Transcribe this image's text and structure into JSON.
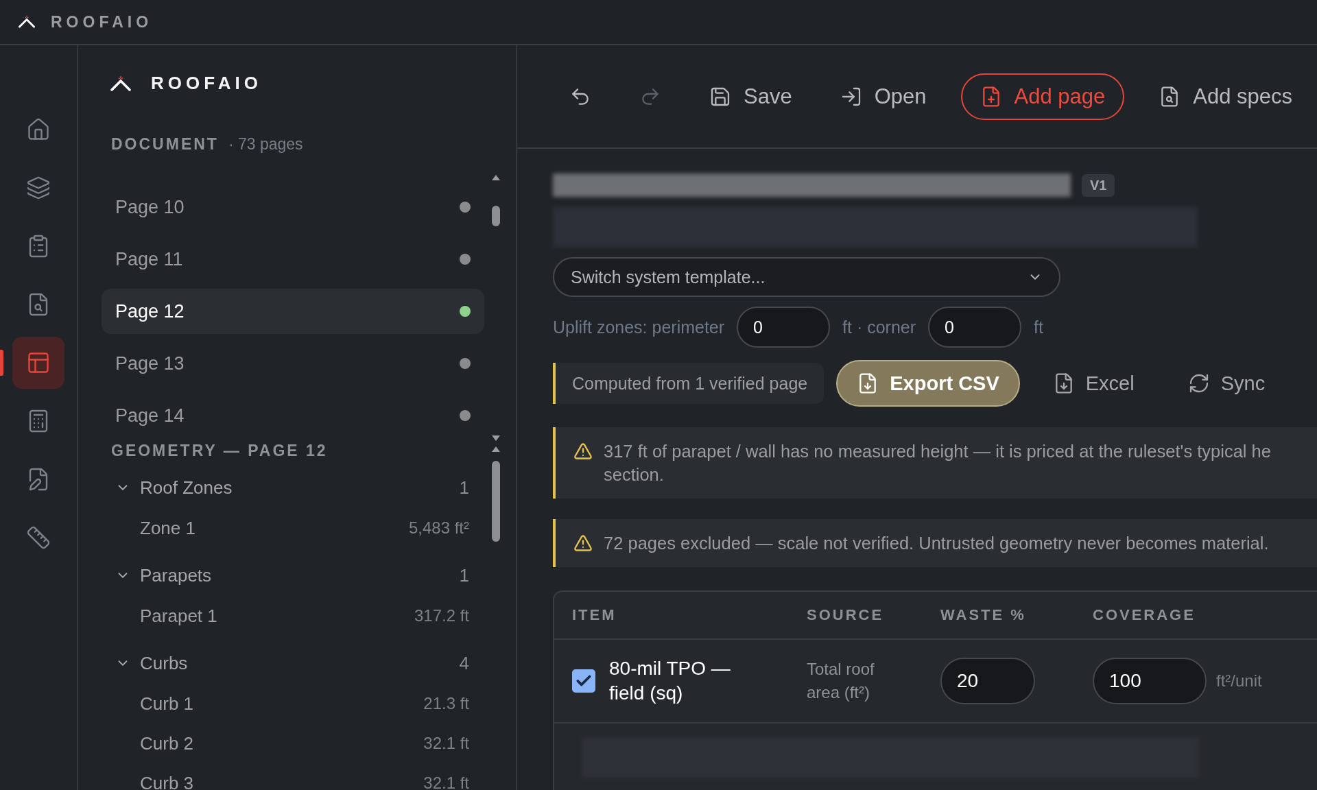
{
  "app_bar": {
    "brand": "ROOFAIO"
  },
  "rail": {
    "items": [
      {
        "selected": false
      },
      {
        "selected": false
      },
      {
        "selected": false
      },
      {
        "selected": false
      },
      {
        "selected": true
      },
      {
        "selected": false
      },
      {
        "selected": false
      },
      {
        "selected": false
      }
    ]
  },
  "sidebar": {
    "brand": "ROOFAIO",
    "document": {
      "heading": "DOCUMENT",
      "count": "· 73 pages",
      "pages": [
        {
          "label": "Page 10",
          "selected": false,
          "color": "#8a8b8d"
        },
        {
          "label": "Page 11",
          "selected": false,
          "color": "#8a8b8d"
        },
        {
          "label": "Page 12",
          "selected": true,
          "color": "#8fd18a"
        },
        {
          "label": "Page 13",
          "selected": false,
          "color": "#8a8b8d"
        },
        {
          "label": "Page 14",
          "selected": false,
          "color": "#8a8b8d"
        }
      ]
    },
    "geometry": {
      "heading": "GEOMETRY — PAGE 12",
      "groups": [
        {
          "label": "Roof Zones",
          "count": "1",
          "expanded": true,
          "children": [
            {
              "label": "Zone 1",
              "value": "5,483 ft²"
            }
          ]
        },
        {
          "label": "Parapets",
          "count": "1",
          "expanded": true,
          "children": [
            {
              "label": "Parapet 1",
              "value": "317.2 ft"
            }
          ]
        },
        {
          "label": "Curbs",
          "count": "4",
          "expanded": true,
          "children": [
            {
              "label": "Curb 1",
              "value": "21.3 ft"
            },
            {
              "label": "Curb 2",
              "value": "32.1 ft"
            },
            {
              "label": "Curb 3",
              "value": "32.1 ft"
            }
          ]
        }
      ]
    }
  },
  "toolbar": {
    "items": [
      {
        "kind": "undo",
        "disabled": false
      },
      {
        "kind": "redo",
        "disabled": true
      },
      {
        "kind": "save",
        "label": "Save",
        "primary": false
      },
      {
        "kind": "open",
        "label": "Open",
        "primary": false
      },
      {
        "kind": "add-page",
        "label": "Add page",
        "primary": true
      },
      {
        "kind": "add-specs",
        "label": "Add specs",
        "primary": false
      }
    ]
  },
  "document": {
    "version": "V1",
    "template_select": {
      "placeholder": "Switch system template..."
    },
    "uplift": {
      "label": "Uplift zones: perimeter",
      "perimeter": "0",
      "separator": "ft · corner",
      "corner": "0",
      "unit": "ft"
    },
    "summary": {
      "note": "Computed from 1 verified page",
      "actions": [
        {
          "kind": "csv",
          "label": "Export CSV",
          "primary": true
        },
        {
          "kind": "excel",
          "label": "Excel",
          "primary": false
        },
        {
          "kind": "sync",
          "label": "Sync",
          "primary": false
        }
      ]
    },
    "alerts": [
      {
        "lines": [
          "317 ft of parapet / wall has no measured height — it is priced at the ruleset's typical he",
          "section."
        ]
      },
      {
        "lines": [
          "72 pages excluded — scale not verified. Untrusted geometry never becomes material."
        ]
      }
    ],
    "table": {
      "columns": [
        "ITEM",
        "SOURCE",
        "WASTE %",
        "COVERAGE"
      ],
      "rows": [
        {
          "checked": true,
          "item": "80-mil TPO — field (sq)",
          "source": "Total roof area (ft²)",
          "waste": "20",
          "coverage": "100",
          "unit": "ft²/unit"
        }
      ]
    }
  }
}
